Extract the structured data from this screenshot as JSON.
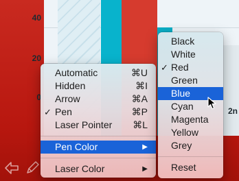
{
  "chart": {
    "ticks": [
      "40",
      "20",
      "0"
    ],
    "partial_xlabel": "2n"
  },
  "toolbar": {
    "icons": [
      "back-arrow-icon",
      "pen-icon"
    ]
  },
  "pointer_menu": {
    "items": [
      {
        "label": "Automatic",
        "shortcut": "⌘U",
        "checked": false
      },
      {
        "label": "Hidden",
        "shortcut": "⌘I",
        "checked": false
      },
      {
        "label": "Arrow",
        "shortcut": "⌘A",
        "checked": false
      },
      {
        "label": "Pen",
        "shortcut": "⌘P",
        "checked": true
      },
      {
        "label": "Laser Pointer",
        "shortcut": "⌘L",
        "checked": false
      }
    ],
    "pen_color_label": "Pen Color",
    "laser_color_label": "Laser Color",
    "check_mark": "✓",
    "submenu_arrow": "▶"
  },
  "pen_color_menu": {
    "items": [
      {
        "label": "Black",
        "checked": false,
        "highlighted": false
      },
      {
        "label": "White",
        "checked": false,
        "highlighted": false
      },
      {
        "label": "Red",
        "checked": true,
        "highlighted": false
      },
      {
        "label": "Green",
        "checked": false,
        "highlighted": false
      },
      {
        "label": "Blue",
        "checked": false,
        "highlighted": true
      },
      {
        "label": "Cyan",
        "checked": false,
        "highlighted": false
      },
      {
        "label": "Magenta",
        "checked": false,
        "highlighted": false
      },
      {
        "label": "Yellow",
        "checked": false,
        "highlighted": false
      },
      {
        "label": "Grey",
        "checked": false,
        "highlighted": false
      }
    ],
    "reset_label": "Reset"
  },
  "colors": {
    "highlight": "#1a63d8",
    "slide_background": "#c8211b",
    "bar_teal": "#08b3cc"
  }
}
